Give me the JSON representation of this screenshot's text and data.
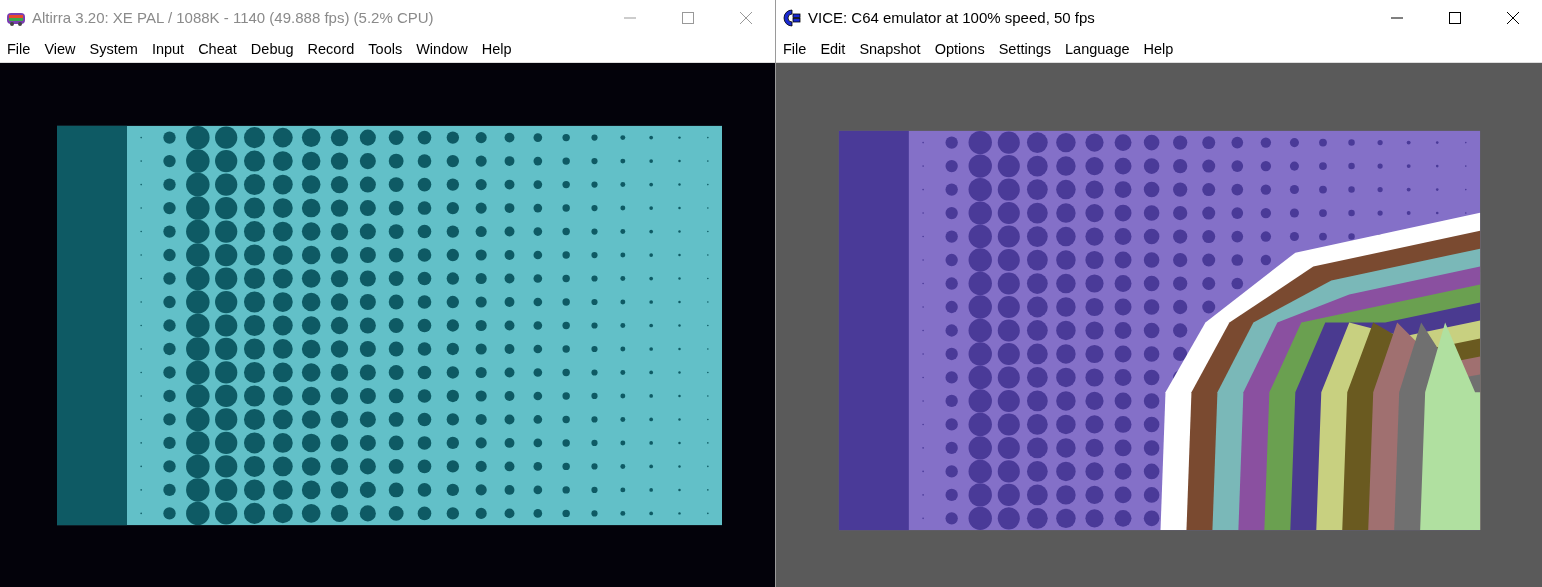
{
  "windows": [
    {
      "kind": "altirra",
      "title": "Altirra 3.20: XE PAL / 1088K - 1140 (49.888 fps) (5.2% CPU)",
      "active": false,
      "menu": [
        "File",
        "View",
        "System",
        "Input",
        "Cheat",
        "Debug",
        "Record",
        "Tools",
        "Window",
        "Help"
      ]
    },
    {
      "kind": "vice",
      "title": "VICE: C64 emulator at 100% speed, 50 fps",
      "active": true,
      "menu": [
        "File",
        "Edit",
        "Snapshot",
        "Options",
        "Settings",
        "Language",
        "Help"
      ]
    }
  ]
}
